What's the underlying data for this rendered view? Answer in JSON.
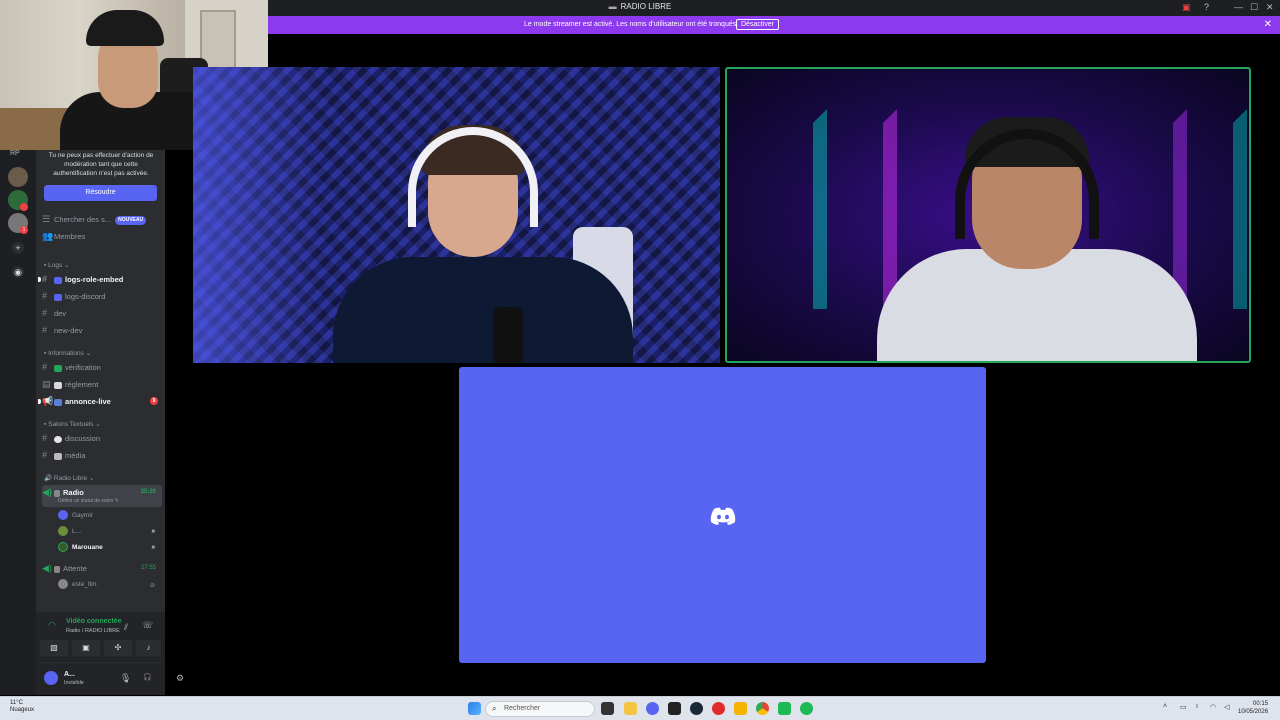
{
  "window": {
    "title": "RADIO LIBRE",
    "controls": [
      "—",
      "☐",
      "✕"
    ]
  },
  "banner": {
    "message": "Le mode streamer est activé. Les noms d'utilisateur ont été tronqués.",
    "button": "Désactiver",
    "close": "✕"
  },
  "servers": {
    "label": "RP",
    "badge1": "1"
  },
  "sidebar": {
    "notice": "Tu ne peux pas effectuer d'action de modération tant que cette authentification n'est pas activée.",
    "resolve_button": "Résoudre",
    "search_label": "Chercher des s...",
    "search_badge": "NOUVEAU",
    "members_label": "Membres",
    "categories": {
      "logs": "Logs",
      "informations": "Informations",
      "salons": "Salons Textuels",
      "radio": "Radio Libre"
    },
    "channels": {
      "logs_role_embed": "logs-role-embed",
      "logs_discord": "logs-discord",
      "dev": "dev",
      "new_dev": "new-dev",
      "verification": "vérification",
      "reglement": "règlement",
      "annonce_live": "annonce-live",
      "annonce_badge": "9",
      "discussion": "discussion",
      "media": "média",
      "radio": "Radio",
      "radio_time": "35:20",
      "radio_status": "Définir un statut de salon",
      "attente": "Attente",
      "attente_time": "27:55"
    },
    "voice_users": {
      "u1": "Gaymir",
      "u2": "L...",
      "u3": "Marouane",
      "u4": "este_fim"
    }
  },
  "voice_panel": {
    "status": "Vidéo connectée",
    "location": "Radio / RADIO LIBRE"
  },
  "user": {
    "name": "A...",
    "status": "Invisible"
  },
  "taskbar": {
    "weather_temp": "11°C",
    "weather_desc": "Nuageux",
    "search_placeholder": "Rechercher",
    "time": "00:15",
    "date": "10/05/2026"
  },
  "colors": {
    "accent": "#5865f2",
    "banner": "#8d3aee",
    "speaking": "#23a55a"
  }
}
